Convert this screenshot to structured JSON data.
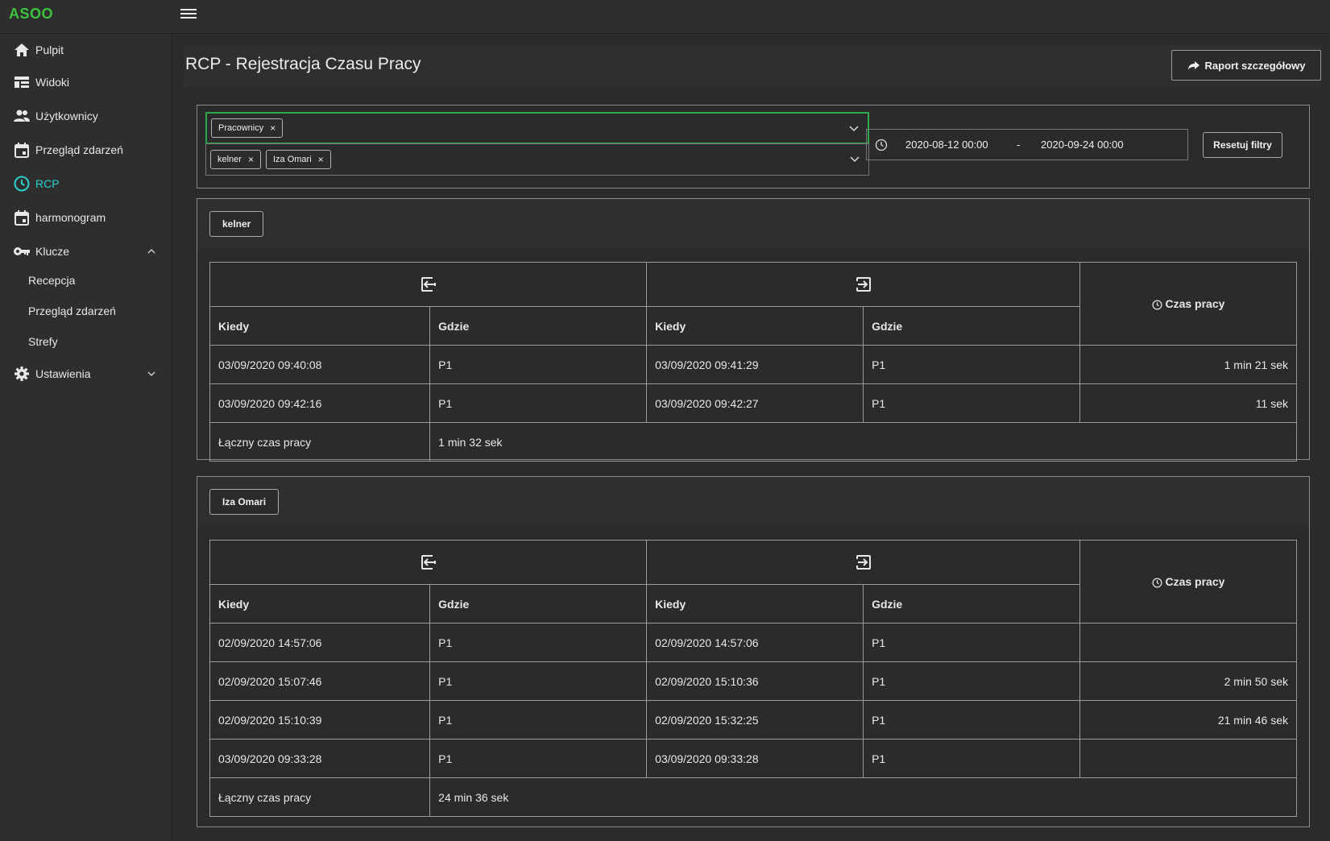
{
  "app": {
    "brand": "ASOO"
  },
  "sidebar": {
    "items": [
      {
        "label": "Pulpit",
        "icon": "home-icon"
      },
      {
        "label": "Widoki",
        "icon": "view-icon"
      },
      {
        "label": "Użytkownicy",
        "icon": "users-icon"
      },
      {
        "label": "Przegląd zdarzeń",
        "icon": "calendar-icon"
      },
      {
        "label": "RCP",
        "icon": "clock-icon",
        "active": true
      },
      {
        "label": "harmonogram",
        "icon": "calendar-icon"
      },
      {
        "label": "Klucze",
        "icon": "key-icon",
        "expanded": true
      },
      {
        "label": "Ustawienia",
        "icon": "gear-icon",
        "expanded": false
      }
    ],
    "sub_items": [
      "Recepcja",
      "Przegląd zdarzeń",
      "Strefy"
    ]
  },
  "header": {
    "title": "RCP - Rejestracja Czasu Pracy",
    "report_button": "Raport szczegółowy"
  },
  "filters": {
    "type_chip": "Pracownicy",
    "employee_chips": [
      "kelner",
      "Iza Omari"
    ],
    "date_from": "2020-08-12 00:00",
    "date_separator": "-",
    "date_to": "2020-09-24 00:00",
    "reset_button": "Resetuj filtry"
  },
  "table_headers": {
    "when": "Kiedy",
    "where": "Gdzie",
    "work_time": "Czas pracy",
    "total_label": "Łączny czas pracy"
  },
  "groups": [
    {
      "name": "kelner",
      "rows": [
        {
          "in_when": "03/09/2020 09:40:08",
          "in_where": "P1",
          "out_when": "03/09/2020 09:41:29",
          "out_where": "P1",
          "time": "1 min 21 sek"
        },
        {
          "in_when": "03/09/2020 09:42:16",
          "in_where": "P1",
          "out_when": "03/09/2020 09:42:27",
          "out_where": "P1",
          "time": "11 sek"
        }
      ],
      "total": "1 min 32 sek"
    },
    {
      "name": "Iza Omari",
      "rows": [
        {
          "in_when": "02/09/2020 14:57:06",
          "in_where": "P1",
          "out_when": "02/09/2020 14:57:06",
          "out_where": "P1",
          "time": ""
        },
        {
          "in_when": "02/09/2020 15:07:46",
          "in_where": "P1",
          "out_when": "02/09/2020 15:10:36",
          "out_where": "P1",
          "time": "2 min 50 sek"
        },
        {
          "in_when": "02/09/2020 15:10:39",
          "in_where": "P1",
          "out_when": "02/09/2020 15:32:25",
          "out_where": "P1",
          "time": "21 min 46 sek"
        },
        {
          "in_when": "03/09/2020 09:33:28",
          "in_where": "P1",
          "out_when": "03/09/2020 09:33:28",
          "out_where": "P1",
          "time": ""
        }
      ],
      "total": "24 min 36 sek"
    }
  ]
}
